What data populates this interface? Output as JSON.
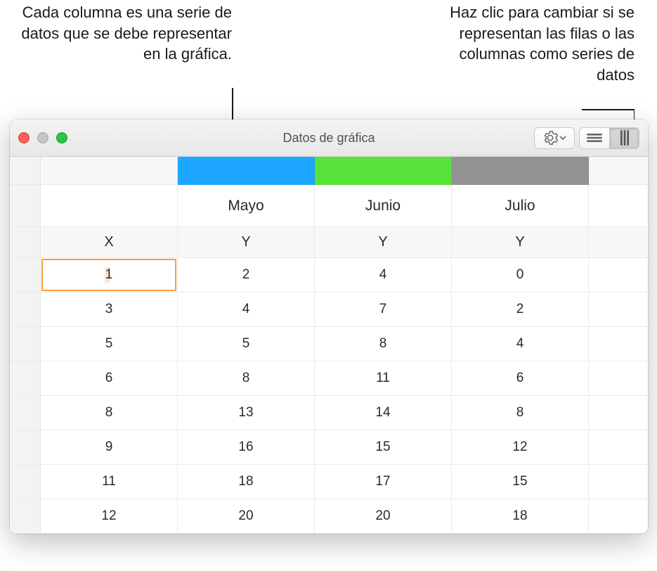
{
  "callouts": {
    "left": "Cada columna es una serie de datos que se debe representar en la gráfica.",
    "right": "Haz clic para cambiar si se representan las filas o las columnas como series de datos"
  },
  "window": {
    "title": "Datos de gráfica"
  },
  "series": [
    {
      "name": "Mayo",
      "color": "#1ca6ff"
    },
    {
      "name": "Junio",
      "color": "#58e33a"
    },
    {
      "name": "Julio",
      "color": "#929292"
    }
  ],
  "axis_headers": {
    "x": "X",
    "y": "Y"
  },
  "rows": [
    {
      "x": "1",
      "y1": "2",
      "y2": "4",
      "y3": "0"
    },
    {
      "x": "3",
      "y1": "4",
      "y2": "7",
      "y3": "2"
    },
    {
      "x": "5",
      "y1": "5",
      "y2": "8",
      "y3": "4"
    },
    {
      "x": "6",
      "y1": "8",
      "y2": "11",
      "y3": "6"
    },
    {
      "x": "8",
      "y1": "13",
      "y2": "14",
      "y3": "8"
    },
    {
      "x": "9",
      "y1": "16",
      "y2": "15",
      "y3": "12"
    },
    {
      "x": "11",
      "y1": "18",
      "y2": "17",
      "y3": "15"
    },
    {
      "x": "12",
      "y1": "20",
      "y2": "20",
      "y3": "18"
    }
  ],
  "chart_data": {
    "type": "table",
    "title": "Datos de gráfica",
    "x_label": "X",
    "series": [
      {
        "name": "Mayo",
        "color": "#1ca6ff",
        "x": [
          1,
          3,
          5,
          6,
          8,
          9,
          11,
          12
        ],
        "y": [
          2,
          4,
          5,
          8,
          13,
          16,
          18,
          20
        ]
      },
      {
        "name": "Junio",
        "color": "#58e33a",
        "x": [
          1,
          3,
          5,
          6,
          8,
          9,
          11,
          12
        ],
        "y": [
          4,
          7,
          8,
          11,
          14,
          15,
          17,
          20
        ]
      },
      {
        "name": "Julio",
        "color": "#929292",
        "x": [
          1,
          3,
          5,
          6,
          8,
          9,
          11,
          12
        ],
        "y": [
          0,
          2,
          4,
          6,
          8,
          12,
          15,
          18
        ]
      }
    ]
  }
}
